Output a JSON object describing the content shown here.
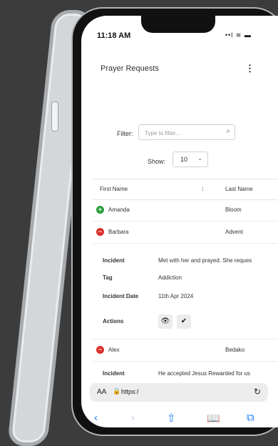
{
  "status": {
    "time": "11:18 AM",
    "icons": "••l ≋ ▬"
  },
  "page": {
    "title": "Prayer Requests",
    "menu_glyph": "⋮"
  },
  "filter": {
    "label": "Filter:",
    "placeholder": "Type to filter...",
    "search_glyph": "⌕"
  },
  "show": {
    "label": "Show:",
    "value": "10",
    "chevron": "⌄"
  },
  "table": {
    "headers": {
      "first": "First Name",
      "last": "Last Name"
    },
    "sort_glyph": "↕",
    "rows": [
      {
        "first": "Amanda",
        "last": "Bloom",
        "status": "expand",
        "color": "#2e9e3e",
        "glyph": "+"
      },
      {
        "first": "Barbara",
        "last": "Advent",
        "status": "collapse",
        "color": "#d9302c",
        "glyph": "−"
      }
    ],
    "detail": {
      "incident_label": "Incident",
      "incident_value": "Met with her and prayed. She reques",
      "tag_label": "Tag",
      "tag_value": "Addiction",
      "date_label": "Incident Date",
      "date_value": "11th Apr 2024",
      "actions_label": "Actions",
      "view_glyph": "👁",
      "check_glyph": "✔"
    },
    "next_row": {
      "first": "Alex",
      "last": "Bedako",
      "color": "#d9302c",
      "glyph": "−"
    },
    "next_detail": {
      "incident_label": "Incident",
      "incident_value": "He accepted Jesus Rewarded for us"
    }
  },
  "browser": {
    "aa": "AA",
    "lock_glyph": "🔒",
    "url": "https:/",
    "reload_glyph": "↻",
    "back_glyph": "‹",
    "forward_glyph": "›",
    "share_glyph": "⇧",
    "bookmarks_glyph": "📖",
    "tabs_glyph": "⧉"
  },
  "colors": {
    "accent": "#1a7cf2",
    "expand": "#2e9e3e",
    "collapse": "#d9302c"
  }
}
